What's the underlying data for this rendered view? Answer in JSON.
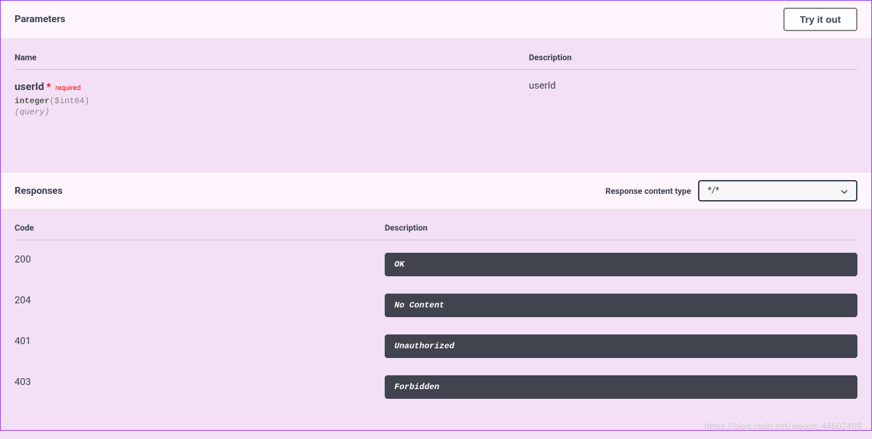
{
  "parameters": {
    "section_title": "Parameters",
    "try_button": "Try it out",
    "headers": {
      "name": "Name",
      "description": "Description"
    },
    "items": [
      {
        "name": "userId",
        "required_label": "required",
        "type": "integer",
        "format": "($int64)",
        "in": "(query)",
        "description": "userId"
      }
    ]
  },
  "responses": {
    "section_title": "Responses",
    "content_type_label": "Response content type",
    "content_type_value": "*/*",
    "headers": {
      "code": "Code",
      "description": "Description"
    },
    "items": [
      {
        "code": "200",
        "description": "OK"
      },
      {
        "code": "204",
        "description": "No Content"
      },
      {
        "code": "401",
        "description": "Unauthorized"
      },
      {
        "code": "403",
        "description": "Forbidden"
      }
    ]
  },
  "watermark": "https://blog.csdn.net/weixin_44602409"
}
